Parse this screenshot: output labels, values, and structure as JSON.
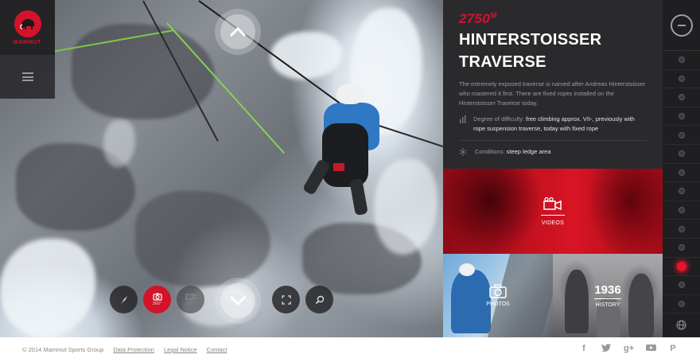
{
  "brand": {
    "logo_text": "MAMMUT"
  },
  "panel": {
    "altitude": "2750",
    "altitude_unit": "M",
    "title": "HINTERSTOISSER TRAVERSE",
    "description": "The extremely exposed traverse is named after Andreas Hinterstoisser who mastered it first. There are fixed ropes installed on the Hinterstoisser Traverse today.",
    "facts": [
      {
        "icon": "bar-chart-icon",
        "label": "Degree of difficulty: ",
        "value": "free climbing approx. VII-, previously with rope suspension traverse, today with fixed rope"
      },
      {
        "icon": "snowflake-icon",
        "label": "Conditions: ",
        "value": "steep ledge area"
      }
    ]
  },
  "tiles": {
    "videos_label": "VIDEOS",
    "photos_label": "PHOTOS",
    "history_year": "1936",
    "history_label": "HISTORY"
  },
  "tools": [
    {
      "name": "compass",
      "label": ""
    },
    {
      "name": "photo-360",
      "label": "360°"
    },
    {
      "name": "video-360",
      "label": "360°"
    },
    {
      "name": "fullscreen",
      "label": ""
    },
    {
      "name": "search",
      "label": ""
    }
  ],
  "sidebar": {
    "dot_count": 14,
    "active_index": 11
  },
  "footer": {
    "copyright": "© 2014 Mammut Sports Group",
    "links": [
      "Data Protection",
      "Legal Notice",
      "Contact"
    ],
    "social": [
      "f",
      "t",
      "g+",
      "yt",
      "p"
    ]
  },
  "colors": {
    "accent": "#d3132a",
    "panel_bg": "#2a2a2d",
    "sidebar_bg": "#1f1f22"
  }
}
